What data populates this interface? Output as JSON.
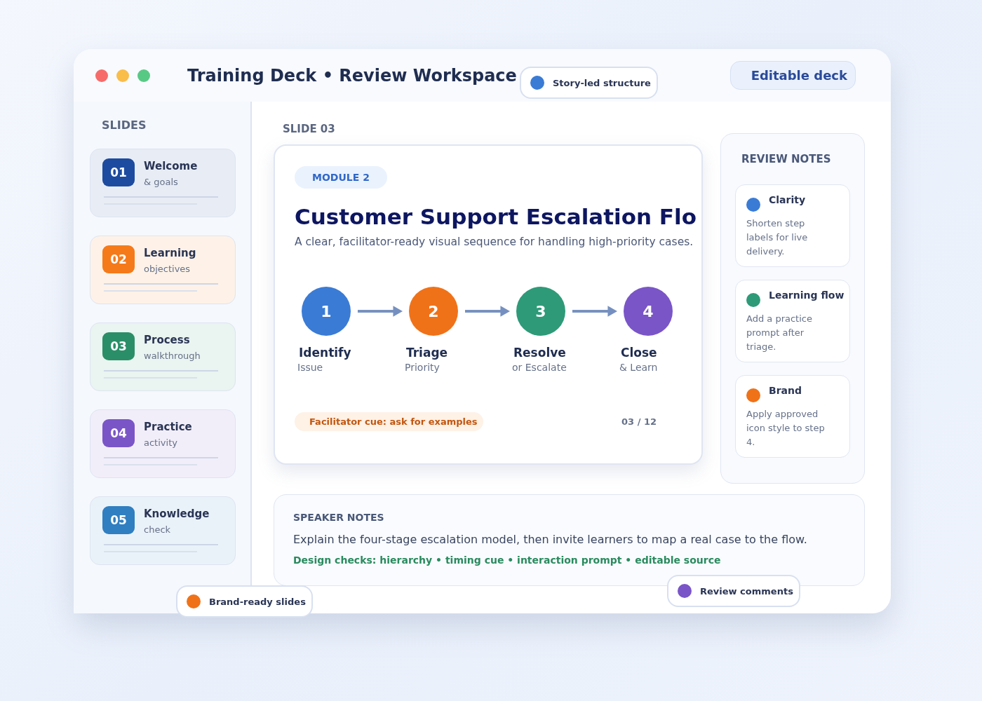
{
  "window": {
    "title": "Training Deck • Review Workspace",
    "action": "Editable deck"
  },
  "chips": [
    {
      "label": "Story-led structure",
      "color": "#3a7bd5"
    },
    {
      "label": "Brand-ready slides",
      "color": "#f07218"
    },
    {
      "label": "Review comments",
      "color": "#7a55c7"
    }
  ],
  "sidebar": {
    "heading": "SLIDES",
    "items": [
      {
        "number": "01",
        "title": "Welcome",
        "subtitle": "& goals",
        "color": "#1d4b9f"
      },
      {
        "number": "02",
        "title": "Learning",
        "subtitle": "objectives",
        "color": "#f57a1a"
      },
      {
        "number": "03",
        "title": "Process",
        "subtitle": "walkthrough",
        "color": "#2a8f68"
      },
      {
        "number": "04",
        "title": "Practice",
        "subtitle": "activity",
        "color": "#7a55c7"
      },
      {
        "number": "05",
        "title": "Knowledge",
        "subtitle": "check",
        "color": "#2f7fc1"
      }
    ]
  },
  "slide": {
    "label": "SLIDE 03",
    "module": "MODULE 2",
    "title": "Customer Support Escalation Flo",
    "subtitle": "A clear, facilitator-ready visual sequence for handling high-priority cases.",
    "steps": [
      {
        "number": "1",
        "title": "Identify",
        "subtitle": "Issue",
        "color": "#3a7bd5"
      },
      {
        "number": "2",
        "title": "Triage",
        "subtitle": "Priority",
        "color": "#f07218"
      },
      {
        "number": "3",
        "title": "Resolve",
        "subtitle": "or Escalate",
        "color": "#2e9a78"
      },
      {
        "number": "4",
        "title": "Close",
        "subtitle": "& Learn",
        "color": "#7a55c7"
      }
    ],
    "cue": "Facilitator cue: ask for examples",
    "page": "03 / 12"
  },
  "review_notes": {
    "heading": "REVIEW NOTES",
    "notes": [
      {
        "title": "Clarity",
        "body": "Shorten step labels for live delivery.",
        "color": "#3a7bd5"
      },
      {
        "title": "Learning flow",
        "body": "Add a practice prompt after triage.",
        "color": "#2e9a78"
      },
      {
        "title": "Brand",
        "body": "Apply approved icon style to step 4.",
        "color": "#f07218"
      }
    ]
  },
  "speaker_notes": {
    "heading": "SPEAKER NOTES",
    "text": "Explain the four-stage escalation model, then invite learners to map a real case to the flow.",
    "checks": "Design checks: hierarchy • timing cue • interaction prompt • editable source"
  }
}
